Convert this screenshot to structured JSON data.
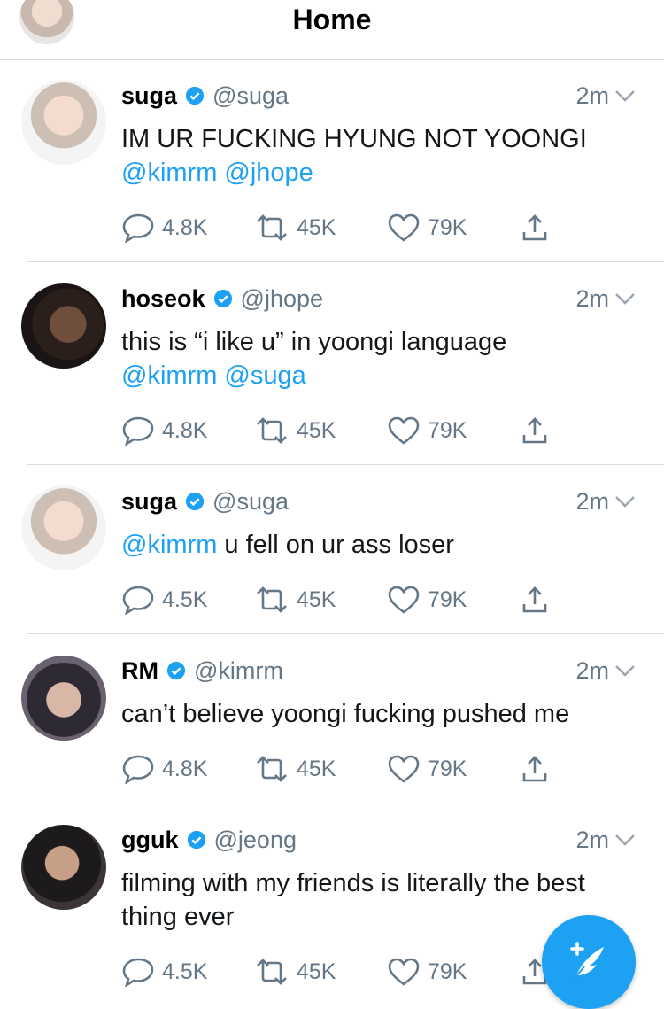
{
  "header": {
    "title": "Home",
    "avatar_icon": "profile-avatar"
  },
  "accent": "#1da1f2",
  "tweets": [
    {
      "name": "suga",
      "handle": "@suga",
      "time": "2m",
      "text": "IM UR FUCKING HYUNG NOT YOONGI",
      "mentions": "@kimrm @jhope",
      "replies": "4.8K",
      "retweets": "45K",
      "likes": "79K"
    },
    {
      "name": "hoseok",
      "handle": "@jhope",
      "time": "2m",
      "text": "this is “i like u” in yoongi language",
      "mentions": "@kimrm @suga",
      "replies": "4.8K",
      "retweets": "45K",
      "likes": "79K"
    },
    {
      "name": "suga",
      "handle": "@suga",
      "time": "2m",
      "mention": "@kimrm",
      "text": " u fell on ur ass loser",
      "replies": "4.5K",
      "retweets": "45K",
      "likes": "79K"
    },
    {
      "name": "RM",
      "handle": "@kimrm",
      "time": "2m",
      "text": "can’t believe yoongi fucking pushed me",
      "replies": "4.8K",
      "retweets": "45K",
      "likes": "79K"
    },
    {
      "name": "gguk",
      "handle": "@jeong",
      "time": "2m",
      "text": "filming with my friends is literally the best thing ever",
      "replies": "4.5K",
      "retweets": "45K",
      "likes": "79K"
    }
  ]
}
